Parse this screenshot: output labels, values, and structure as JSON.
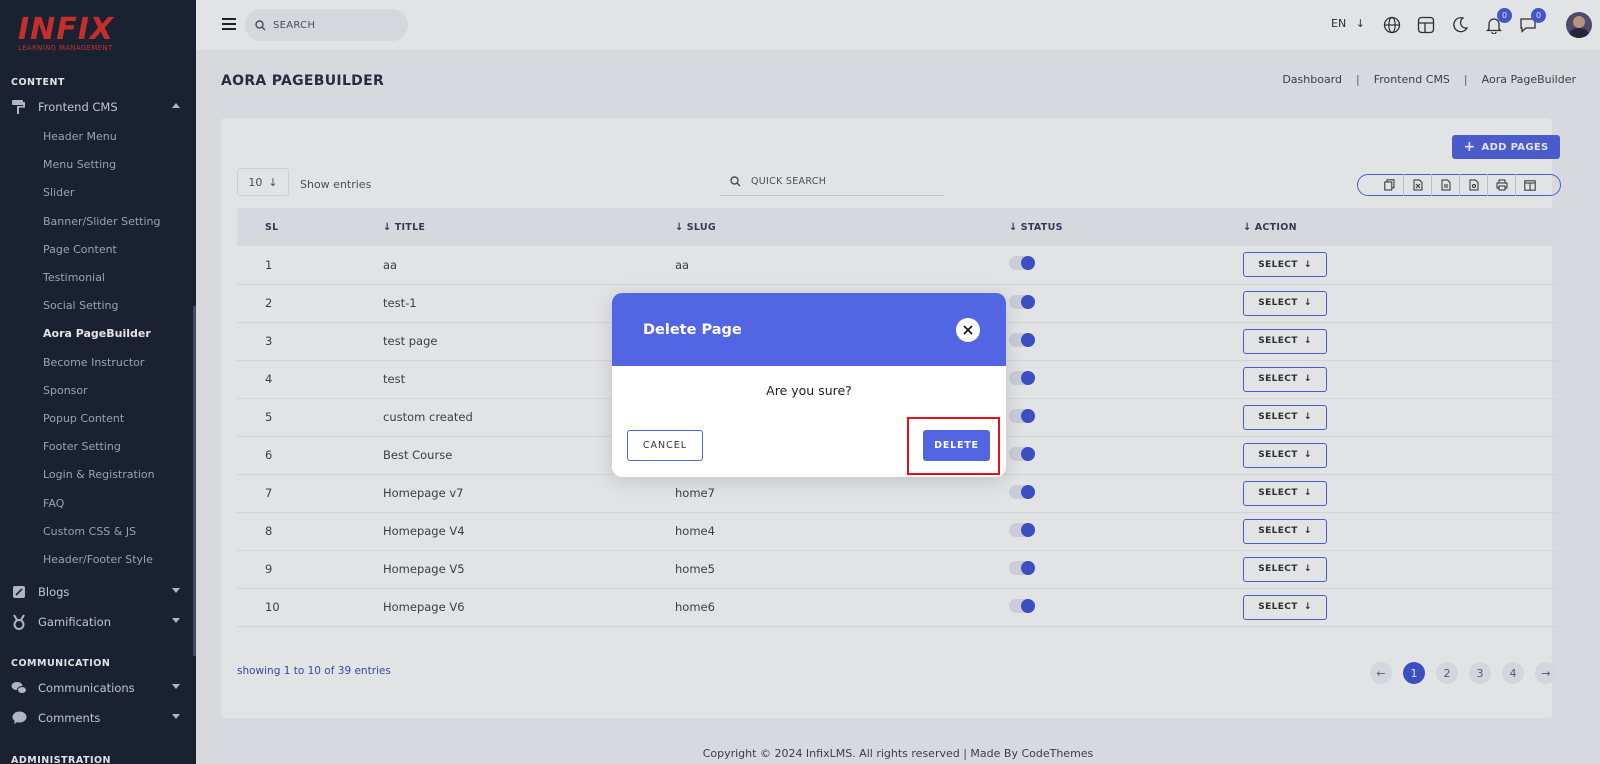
{
  "app": {
    "logo_text": "INFIX",
    "logo_subtitle": "LEARNING MANAGEMENT"
  },
  "colors": {
    "accent": "#5266e3",
    "sidebar_bg": "#1c2434",
    "logo_red": "#e0322d",
    "highlight_red": "#e4101c"
  },
  "sidebar": {
    "content_section": "CONTENT",
    "frontend_cms": "Frontend CMS",
    "sub_items": [
      "Header Menu",
      "Menu Setting",
      "Slider",
      "Banner/Slider Setting",
      "Page Content",
      "Testimonial",
      "Social Setting",
      "Aora PageBuilder",
      "Become Instructor",
      "Sponsor",
      "Popup Content",
      "Footer Setting",
      "Login & Registration",
      "FAQ",
      "Custom CSS & JS",
      "Header/Footer Style"
    ],
    "active_item": "Aora PageBuilder",
    "blogs": "Blogs",
    "gamification": "Gamification",
    "communication_section": "COMMUNICATION",
    "communications": "Communications",
    "comments": "Comments",
    "administration_section": "ADMINISTRATION"
  },
  "topbar": {
    "search_placeholder": "SEARCH",
    "language": "EN",
    "notifications_count": "0",
    "messages_count": "0"
  },
  "page": {
    "title": "AORA PAGEBUILDER",
    "breadcrumb": [
      "Dashboard",
      "Frontend CMS",
      "Aora PageBuilder"
    ],
    "breadcrumb_sep": "|"
  },
  "toolbar": {
    "add_pages": "ADD PAGES",
    "entries_value": "10",
    "show_entries": "Show entries",
    "quick_search_placeholder": "QUICK SEARCH"
  },
  "table": {
    "headers": {
      "sl": "SL",
      "title": "TITLE",
      "slug": "SLUG",
      "status": "STATUS",
      "action": "ACTION"
    },
    "select_label": "SELECT",
    "rows": [
      {
        "sl": "1",
        "title": "aa",
        "slug": "aa"
      },
      {
        "sl": "2",
        "title": "test-1",
        "slug": ""
      },
      {
        "sl": "3",
        "title": "test page",
        "slug": ""
      },
      {
        "sl": "4",
        "title": "test",
        "slug": ""
      },
      {
        "sl": "5",
        "title": "custom created",
        "slug": ""
      },
      {
        "sl": "6",
        "title": "Best Course",
        "slug": ""
      },
      {
        "sl": "7",
        "title": "Homepage v7",
        "slug": "home7"
      },
      {
        "sl": "8",
        "title": "Homepage V4",
        "slug": "home4"
      },
      {
        "sl": "9",
        "title": "Homepage V5",
        "slug": "home5"
      },
      {
        "sl": "10",
        "title": "Homepage V6",
        "slug": "home6"
      }
    ]
  },
  "pagination": {
    "showing": "showing 1 to 10 of 39 entries",
    "pages": [
      "1",
      "2",
      "3",
      "4"
    ],
    "current": "1"
  },
  "footer": {
    "text": "Copyright © 2024 InfixLMS. All rights reserved | Made By CodeThemes"
  },
  "modal": {
    "title": "Delete Page",
    "message": "Are you sure?",
    "cancel": "CANCEL",
    "delete": "DELETE"
  }
}
